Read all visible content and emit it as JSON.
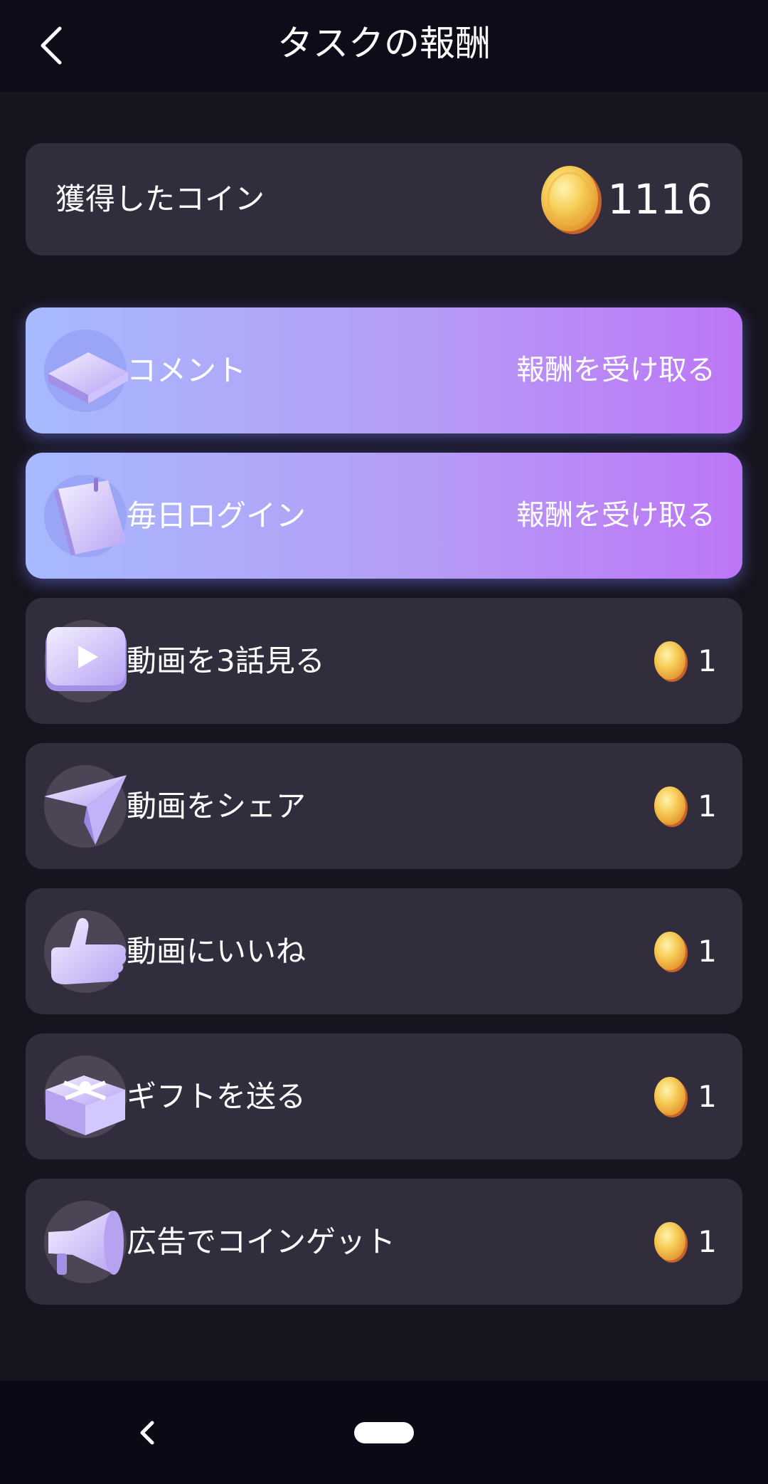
{
  "header": {
    "title": "タスクの報酬",
    "back_icon": "back-arrow-icon"
  },
  "balance": {
    "label": "獲得したコイン",
    "value": "1116",
    "icon": "coin-icon"
  },
  "tasks": [
    {
      "label": "コメント",
      "icon": "book-icon",
      "status": "claimable",
      "action_label": "報酬を受け取る"
    },
    {
      "label": "毎日ログイン",
      "icon": "calendar-icon",
      "status": "claimable",
      "action_label": "報酬を受け取る"
    },
    {
      "label": "動画を3話見る",
      "icon": "play-icon",
      "status": "pending",
      "reward": "1"
    },
    {
      "label": "動画をシェア",
      "icon": "paper-plane-icon",
      "status": "pending",
      "reward": "1"
    },
    {
      "label": "動画にいいね",
      "icon": "thumbs-up-icon",
      "status": "pending",
      "reward": "1"
    },
    {
      "label": "ギフトを送る",
      "icon": "gift-icon",
      "status": "pending",
      "reward": "1"
    },
    {
      "label": "広告でコインゲット",
      "icon": "megaphone-icon",
      "status": "pending",
      "reward": "1"
    }
  ],
  "colors": {
    "background": "#17141f",
    "header": "#0f0c19",
    "card": "#322d3d",
    "active_gradient_start": "#a7baff",
    "active_gradient_end": "#bd76f6",
    "coin": "#f2b93a"
  },
  "navbar": {
    "back_icon": "nav-back-icon",
    "home_icon": "home-pill-icon"
  }
}
